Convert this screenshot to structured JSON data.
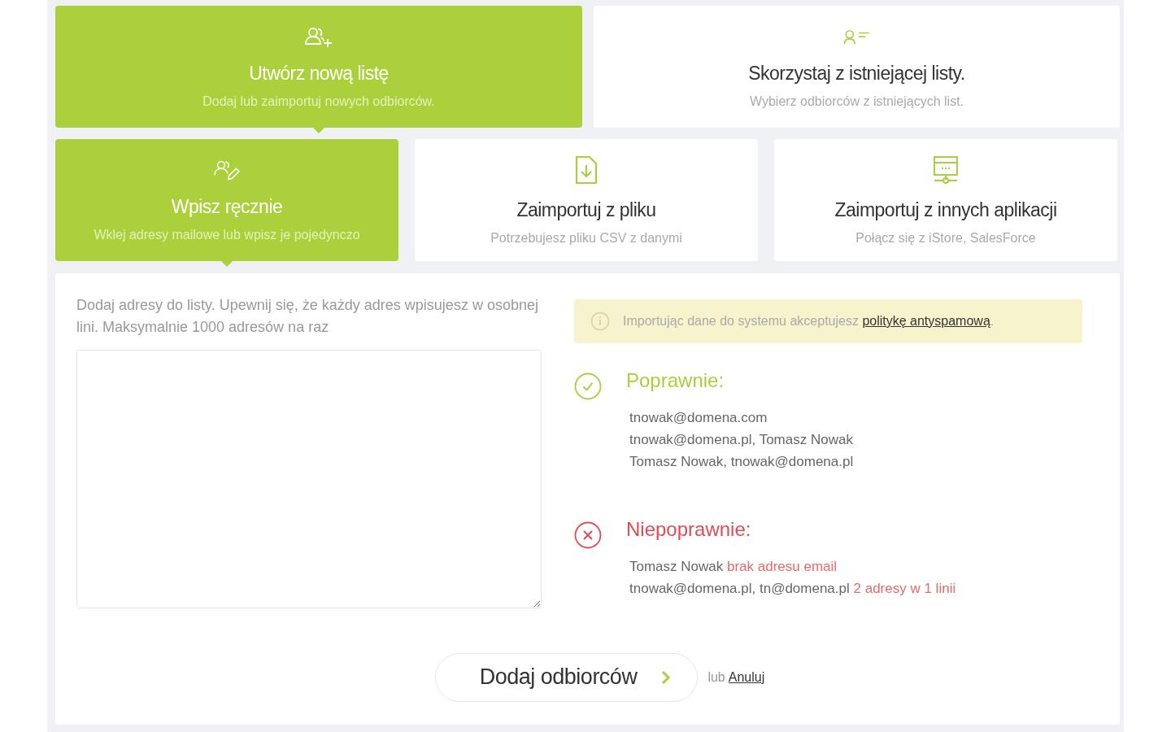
{
  "list_options": [
    {
      "kind": "new-list",
      "title": "Utwórz nową listę",
      "subtitle": "Dodaj lub zaimportuj nowych odbiorców.",
      "selected": true
    },
    {
      "kind": "existing-list",
      "title": "Skorzystaj z istniejącej listy.",
      "subtitle": "Wybierz odbiorców z istniejących list.",
      "selected": false
    }
  ],
  "input_methods": [
    {
      "kind": "manual",
      "title": "Wpisz ręcznie",
      "subtitle": "Wklej adresy mailowe lub wpisz je pojedynczo",
      "selected": true
    },
    {
      "kind": "file",
      "title": "Zaimportuj z pliku",
      "subtitle": "Potrzebujesz pliku CSV z danymi",
      "selected": false
    },
    {
      "kind": "apps",
      "title": "Zaimportuj z innych aplikacji",
      "subtitle": "Połącz się z iStore, SalesForce",
      "selected": false
    }
  ],
  "manual_entry": {
    "instructions": "Dodaj adresy do listy. Upewnij się, że każdy adres wpisujesz w osobnej lini. Maksymalnie 1000 adresów na raz"
  },
  "notice": {
    "text": "Importując dane do systemu akceptujesz",
    "link": "politykę antyspamową",
    "trailing": "."
  },
  "valid": {
    "title": "Poprawnie:",
    "lines": [
      "tnowak@domena.com",
      "tnowak@domena.pl, Tomasz Nowak",
      "Tomasz Nowak, tnowak@domena.pl"
    ]
  },
  "invalid": {
    "title": "Niepoprawnie:",
    "lines": [
      {
        "text": "Tomasz Nowak",
        "error": "brak adresu email"
      },
      {
        "text": "tnowak@domena.pl, tn@domena.pl",
        "error": "2 adresy w 1 linii"
      }
    ]
  },
  "actions": {
    "submit": "Dodaj odbiorców",
    "separator": "lub",
    "cancel": "Anuluj"
  }
}
